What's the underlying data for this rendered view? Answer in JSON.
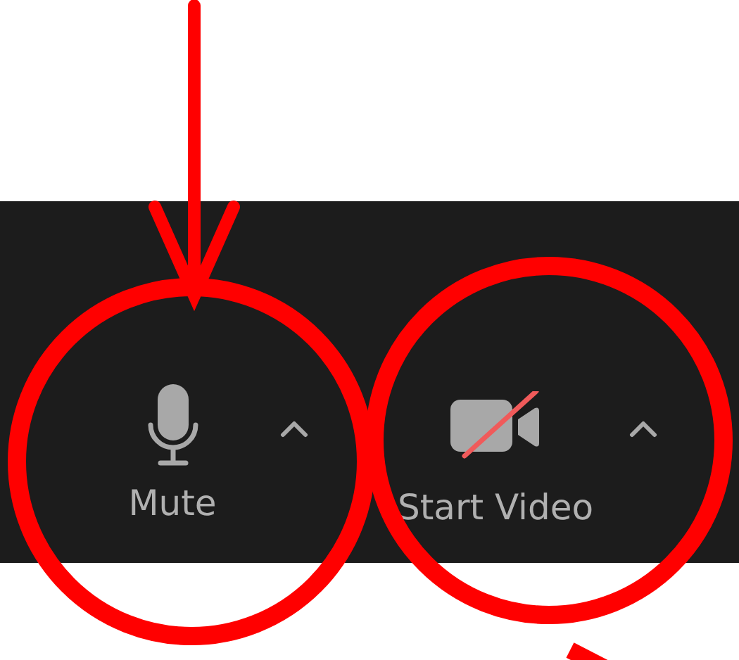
{
  "toolbar": {
    "buttons": [
      {
        "kind": "mic",
        "label": "Mute",
        "off": false
      },
      {
        "kind": "video",
        "label": "Start Video",
        "off": true
      }
    ]
  }
}
